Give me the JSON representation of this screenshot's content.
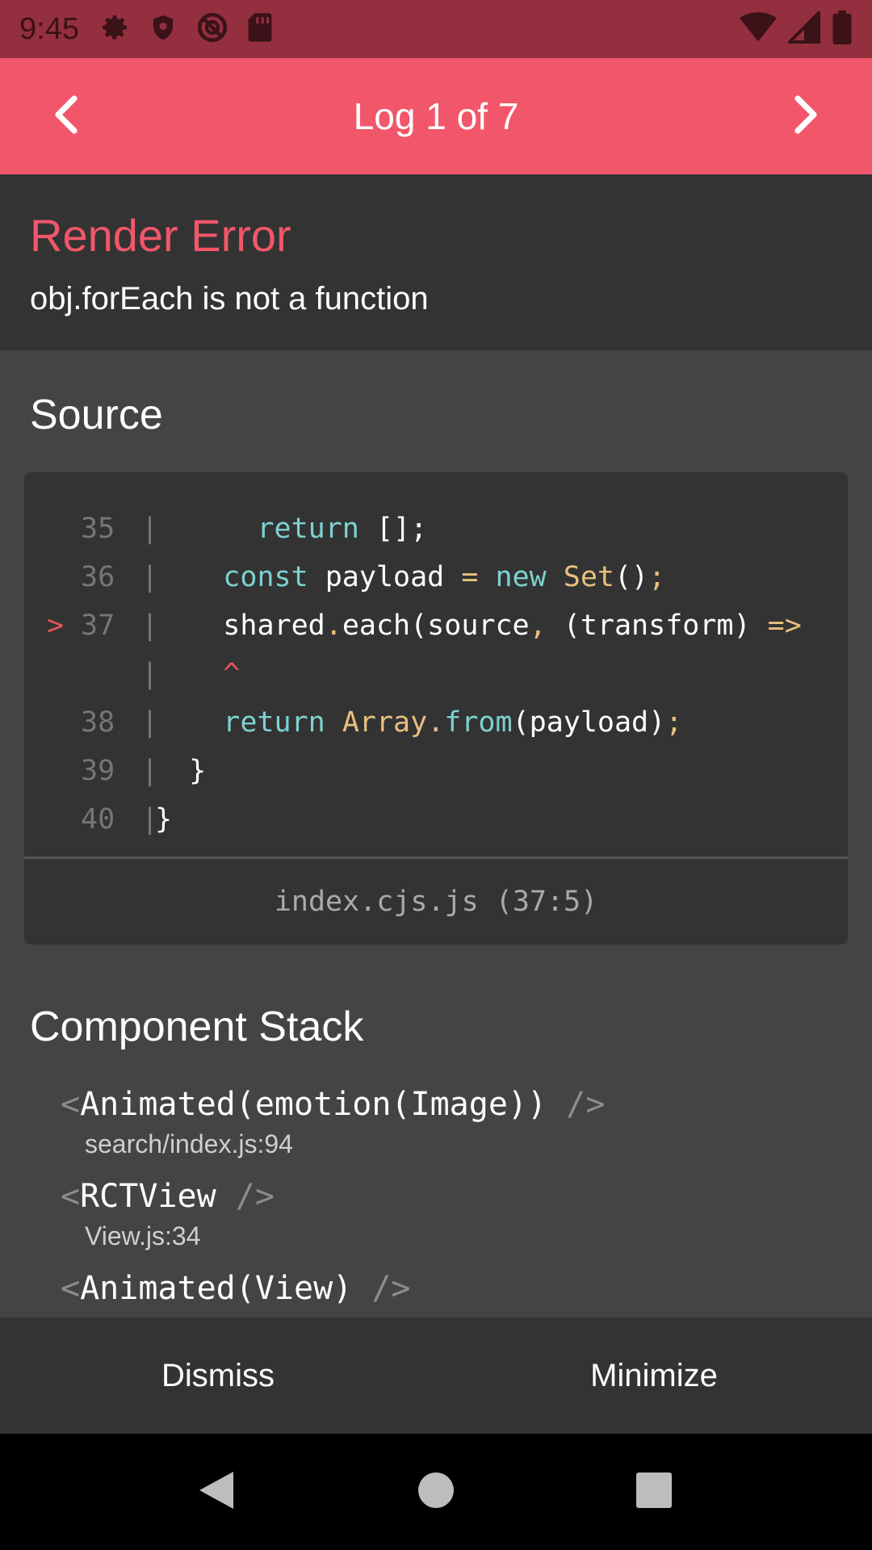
{
  "status_bar": {
    "time": "9:45",
    "left_icons": [
      "gear-icon",
      "shield-icon",
      "no-tracking-icon",
      "sd-card-icon"
    ],
    "right_icons": [
      "wifi-icon",
      "signal-icon",
      "battery-icon"
    ]
  },
  "header": {
    "title": "Log 1 of 7",
    "prev_icon": "chevron-left-icon",
    "next_icon": "chevron-right-icon"
  },
  "error": {
    "title": "Render Error",
    "message": "obj.forEach is not a function"
  },
  "source": {
    "heading": "Source",
    "lines": [
      {
        "marker": "",
        "num": "35",
        "bar": "|",
        "indent": "      ",
        "tokens": [
          {
            "t": "return",
            "c": "kw"
          },
          {
            "t": " [];",
            "c": ""
          }
        ]
      },
      {
        "marker": "",
        "num": "36",
        "bar": "|",
        "indent": "    ",
        "tokens": [
          {
            "t": "const",
            "c": "kw"
          },
          {
            "t": " payload ",
            "c": ""
          },
          {
            "t": "=",
            "c": "op"
          },
          {
            "t": " ",
            "c": ""
          },
          {
            "t": "new",
            "c": "kw"
          },
          {
            "t": " ",
            "c": ""
          },
          {
            "t": "Set",
            "c": "fn"
          },
          {
            "t": "()",
            "c": ""
          },
          {
            "t": ";",
            "c": "op"
          }
        ]
      },
      {
        "marker": ">",
        "num": "37",
        "bar": "|",
        "indent": "    ",
        "tokens": [
          {
            "t": "shared",
            "c": ""
          },
          {
            "t": ".",
            "c": "op"
          },
          {
            "t": "each(source",
            "c": ""
          },
          {
            "t": ",",
            "c": "op"
          },
          {
            "t": " (transform) ",
            "c": ""
          },
          {
            "t": "=>",
            "c": "op"
          }
        ]
      },
      {
        "marker": "",
        "num": "",
        "bar": "|",
        "indent": "    ",
        "tokens": [
          {
            "t": "^",
            "c": "caret"
          }
        ]
      },
      {
        "marker": "",
        "num": "38",
        "bar": "|",
        "indent": "    ",
        "tokens": [
          {
            "t": "return",
            "c": "kw"
          },
          {
            "t": " ",
            "c": ""
          },
          {
            "t": "Array",
            "c": "fn"
          },
          {
            "t": ".",
            "c": "op"
          },
          {
            "t": "from",
            "c": "kw"
          },
          {
            "t": "(payload)",
            "c": ""
          },
          {
            "t": ";",
            "c": "op"
          }
        ]
      },
      {
        "marker": "",
        "num": "39",
        "bar": "|",
        "indent": "  ",
        "tokens": [
          {
            "t": "}",
            "c": ""
          }
        ]
      },
      {
        "marker": "",
        "num": "40",
        "bar": "|",
        "indent": "",
        "tokens": [
          {
            "t": "}",
            "c": ""
          }
        ]
      }
    ],
    "file": "index.cjs.js (37:5)"
  },
  "component_stack": {
    "heading": "Component Stack",
    "items": [
      {
        "open": "<",
        "name": "Animated(emotion(Image))",
        "close": " />",
        "location": "search/index.js:94"
      },
      {
        "open": "<",
        "name": "RCTView",
        "close": " />",
        "location": "View.js:34"
      },
      {
        "open": "<",
        "name": "Animated(View)",
        "close": " />",
        "location": ""
      }
    ]
  },
  "footer": {
    "dismiss_label": "Dismiss",
    "minimize_label": "Minimize"
  },
  "system_nav": {
    "back_icon": "back-triangle-icon",
    "home_icon": "home-circle-icon",
    "recents_icon": "recents-square-icon"
  },
  "colors": {
    "status_bar": "#932F3E",
    "header": "#F2566A",
    "error_title": "#F2566A",
    "panel_dark": "#333333",
    "panel_body": "#444444",
    "keyword": "#7DD1D0",
    "function": "#E8C07D"
  }
}
